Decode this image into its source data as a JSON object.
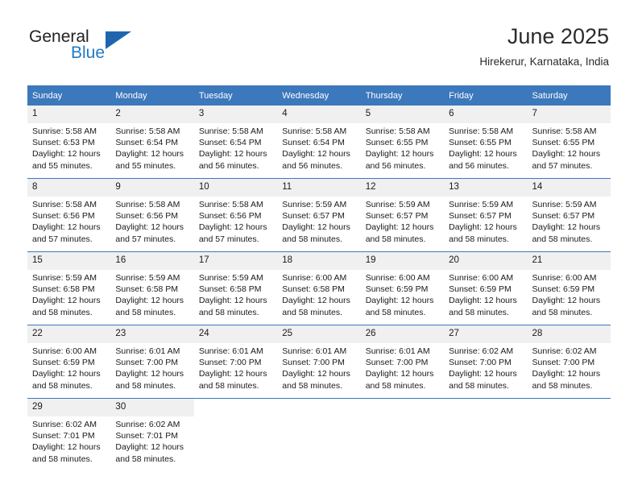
{
  "brand": {
    "name_part1": "General",
    "name_part2": "Blue",
    "triangle_icon": "triangle-icon"
  },
  "header": {
    "title": "June 2025",
    "subtitle": "Hirekerur, Karnataka, India"
  },
  "calendar": {
    "day_headers": [
      "Sunday",
      "Monday",
      "Tuesday",
      "Wednesday",
      "Thursday",
      "Friday",
      "Saturday"
    ],
    "accent_color": "#3c78bc",
    "daynum_bg": "#f0f0f0",
    "weeks": [
      [
        {
          "day": "1",
          "sunrise": "Sunrise: 5:58 AM",
          "sunset": "Sunset: 6:53 PM",
          "daylight1": "Daylight: 12 hours",
          "daylight2": "and 55 minutes."
        },
        {
          "day": "2",
          "sunrise": "Sunrise: 5:58 AM",
          "sunset": "Sunset: 6:54 PM",
          "daylight1": "Daylight: 12 hours",
          "daylight2": "and 55 minutes."
        },
        {
          "day": "3",
          "sunrise": "Sunrise: 5:58 AM",
          "sunset": "Sunset: 6:54 PM",
          "daylight1": "Daylight: 12 hours",
          "daylight2": "and 56 minutes."
        },
        {
          "day": "4",
          "sunrise": "Sunrise: 5:58 AM",
          "sunset": "Sunset: 6:54 PM",
          "daylight1": "Daylight: 12 hours",
          "daylight2": "and 56 minutes."
        },
        {
          "day": "5",
          "sunrise": "Sunrise: 5:58 AM",
          "sunset": "Sunset: 6:55 PM",
          "daylight1": "Daylight: 12 hours",
          "daylight2": "and 56 minutes."
        },
        {
          "day": "6",
          "sunrise": "Sunrise: 5:58 AM",
          "sunset": "Sunset: 6:55 PM",
          "daylight1": "Daylight: 12 hours",
          "daylight2": "and 56 minutes."
        },
        {
          "day": "7",
          "sunrise": "Sunrise: 5:58 AM",
          "sunset": "Sunset: 6:55 PM",
          "daylight1": "Daylight: 12 hours",
          "daylight2": "and 57 minutes."
        }
      ],
      [
        {
          "day": "8",
          "sunrise": "Sunrise: 5:58 AM",
          "sunset": "Sunset: 6:56 PM",
          "daylight1": "Daylight: 12 hours",
          "daylight2": "and 57 minutes."
        },
        {
          "day": "9",
          "sunrise": "Sunrise: 5:58 AM",
          "sunset": "Sunset: 6:56 PM",
          "daylight1": "Daylight: 12 hours",
          "daylight2": "and 57 minutes."
        },
        {
          "day": "10",
          "sunrise": "Sunrise: 5:58 AM",
          "sunset": "Sunset: 6:56 PM",
          "daylight1": "Daylight: 12 hours",
          "daylight2": "and 57 minutes."
        },
        {
          "day": "11",
          "sunrise": "Sunrise: 5:59 AM",
          "sunset": "Sunset: 6:57 PM",
          "daylight1": "Daylight: 12 hours",
          "daylight2": "and 58 minutes."
        },
        {
          "day": "12",
          "sunrise": "Sunrise: 5:59 AM",
          "sunset": "Sunset: 6:57 PM",
          "daylight1": "Daylight: 12 hours",
          "daylight2": "and 58 minutes."
        },
        {
          "day": "13",
          "sunrise": "Sunrise: 5:59 AM",
          "sunset": "Sunset: 6:57 PM",
          "daylight1": "Daylight: 12 hours",
          "daylight2": "and 58 minutes."
        },
        {
          "day": "14",
          "sunrise": "Sunrise: 5:59 AM",
          "sunset": "Sunset: 6:57 PM",
          "daylight1": "Daylight: 12 hours",
          "daylight2": "and 58 minutes."
        }
      ],
      [
        {
          "day": "15",
          "sunrise": "Sunrise: 5:59 AM",
          "sunset": "Sunset: 6:58 PM",
          "daylight1": "Daylight: 12 hours",
          "daylight2": "and 58 minutes."
        },
        {
          "day": "16",
          "sunrise": "Sunrise: 5:59 AM",
          "sunset": "Sunset: 6:58 PM",
          "daylight1": "Daylight: 12 hours",
          "daylight2": "and 58 minutes."
        },
        {
          "day": "17",
          "sunrise": "Sunrise: 5:59 AM",
          "sunset": "Sunset: 6:58 PM",
          "daylight1": "Daylight: 12 hours",
          "daylight2": "and 58 minutes."
        },
        {
          "day": "18",
          "sunrise": "Sunrise: 6:00 AM",
          "sunset": "Sunset: 6:58 PM",
          "daylight1": "Daylight: 12 hours",
          "daylight2": "and 58 minutes."
        },
        {
          "day": "19",
          "sunrise": "Sunrise: 6:00 AM",
          "sunset": "Sunset: 6:59 PM",
          "daylight1": "Daylight: 12 hours",
          "daylight2": "and 58 minutes."
        },
        {
          "day": "20",
          "sunrise": "Sunrise: 6:00 AM",
          "sunset": "Sunset: 6:59 PM",
          "daylight1": "Daylight: 12 hours",
          "daylight2": "and 58 minutes."
        },
        {
          "day": "21",
          "sunrise": "Sunrise: 6:00 AM",
          "sunset": "Sunset: 6:59 PM",
          "daylight1": "Daylight: 12 hours",
          "daylight2": "and 58 minutes."
        }
      ],
      [
        {
          "day": "22",
          "sunrise": "Sunrise: 6:00 AM",
          "sunset": "Sunset: 6:59 PM",
          "daylight1": "Daylight: 12 hours",
          "daylight2": "and 58 minutes."
        },
        {
          "day": "23",
          "sunrise": "Sunrise: 6:01 AM",
          "sunset": "Sunset: 7:00 PM",
          "daylight1": "Daylight: 12 hours",
          "daylight2": "and 58 minutes."
        },
        {
          "day": "24",
          "sunrise": "Sunrise: 6:01 AM",
          "sunset": "Sunset: 7:00 PM",
          "daylight1": "Daylight: 12 hours",
          "daylight2": "and 58 minutes."
        },
        {
          "day": "25",
          "sunrise": "Sunrise: 6:01 AM",
          "sunset": "Sunset: 7:00 PM",
          "daylight1": "Daylight: 12 hours",
          "daylight2": "and 58 minutes."
        },
        {
          "day": "26",
          "sunrise": "Sunrise: 6:01 AM",
          "sunset": "Sunset: 7:00 PM",
          "daylight1": "Daylight: 12 hours",
          "daylight2": "and 58 minutes."
        },
        {
          "day": "27",
          "sunrise": "Sunrise: 6:02 AM",
          "sunset": "Sunset: 7:00 PM",
          "daylight1": "Daylight: 12 hours",
          "daylight2": "and 58 minutes."
        },
        {
          "day": "28",
          "sunrise": "Sunrise: 6:02 AM",
          "sunset": "Sunset: 7:00 PM",
          "daylight1": "Daylight: 12 hours",
          "daylight2": "and 58 minutes."
        }
      ],
      [
        {
          "day": "29",
          "sunrise": "Sunrise: 6:02 AM",
          "sunset": "Sunset: 7:01 PM",
          "daylight1": "Daylight: 12 hours",
          "daylight2": "and 58 minutes."
        },
        {
          "day": "30",
          "sunrise": "Sunrise: 6:02 AM",
          "sunset": "Sunset: 7:01 PM",
          "daylight1": "Daylight: 12 hours",
          "daylight2": "and 58 minutes."
        },
        {
          "day": "",
          "sunrise": "",
          "sunset": "",
          "daylight1": "",
          "daylight2": ""
        },
        {
          "day": "",
          "sunrise": "",
          "sunset": "",
          "daylight1": "",
          "daylight2": ""
        },
        {
          "day": "",
          "sunrise": "",
          "sunset": "",
          "daylight1": "",
          "daylight2": ""
        },
        {
          "day": "",
          "sunrise": "",
          "sunset": "",
          "daylight1": "",
          "daylight2": ""
        },
        {
          "day": "",
          "sunrise": "",
          "sunset": "",
          "daylight1": "",
          "daylight2": ""
        }
      ]
    ]
  }
}
